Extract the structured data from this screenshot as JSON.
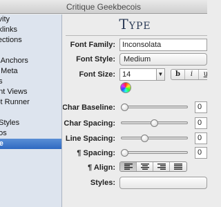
{
  "window": {
    "title": "Critique Geekbecois"
  },
  "sidebar": {
    "items": [
      {
        "label": "tivity"
      },
      {
        "label": "cklinks"
      },
      {
        "label": "llections"
      },
      {
        "label": "e"
      },
      {
        "label": "e Anchors"
      },
      {
        "label": "e Meta"
      },
      {
        "label": "es"
      },
      {
        "label": "ent Views"
      },
      {
        "label": "ipt Runner"
      },
      {
        "label": "s"
      },
      {
        "label": "t Styles"
      },
      {
        "label": "dos"
      },
      {
        "label": "pe",
        "selected": true
      }
    ]
  },
  "panel": {
    "title": "Type",
    "font_family": {
      "label": "Font Family:",
      "value": "Inconsolata"
    },
    "font_style": {
      "label": "Font Style:",
      "value": "Medium"
    },
    "font_size": {
      "label": "Font Size:",
      "value": "14",
      "style_buttons": [
        "b",
        "i",
        "u"
      ]
    },
    "char_baseline": {
      "label": "Char Baseline:",
      "value": "0",
      "level": 0.0
    },
    "char_spacing": {
      "label": "Char Spacing:",
      "value": "0",
      "level": 0.5
    },
    "line_spacing": {
      "label": "Line Spacing:",
      "value": "0",
      "level": 0.3
    },
    "para_spacing": {
      "label": "¶ Spacing:",
      "value": "0",
      "level": 0.0
    },
    "para_align": {
      "label": "¶ Align:",
      "options": [
        "left",
        "center",
        "right",
        "justify"
      ],
      "selected": "left"
    },
    "styles": {
      "label": "Styles:",
      "value": ""
    }
  }
}
